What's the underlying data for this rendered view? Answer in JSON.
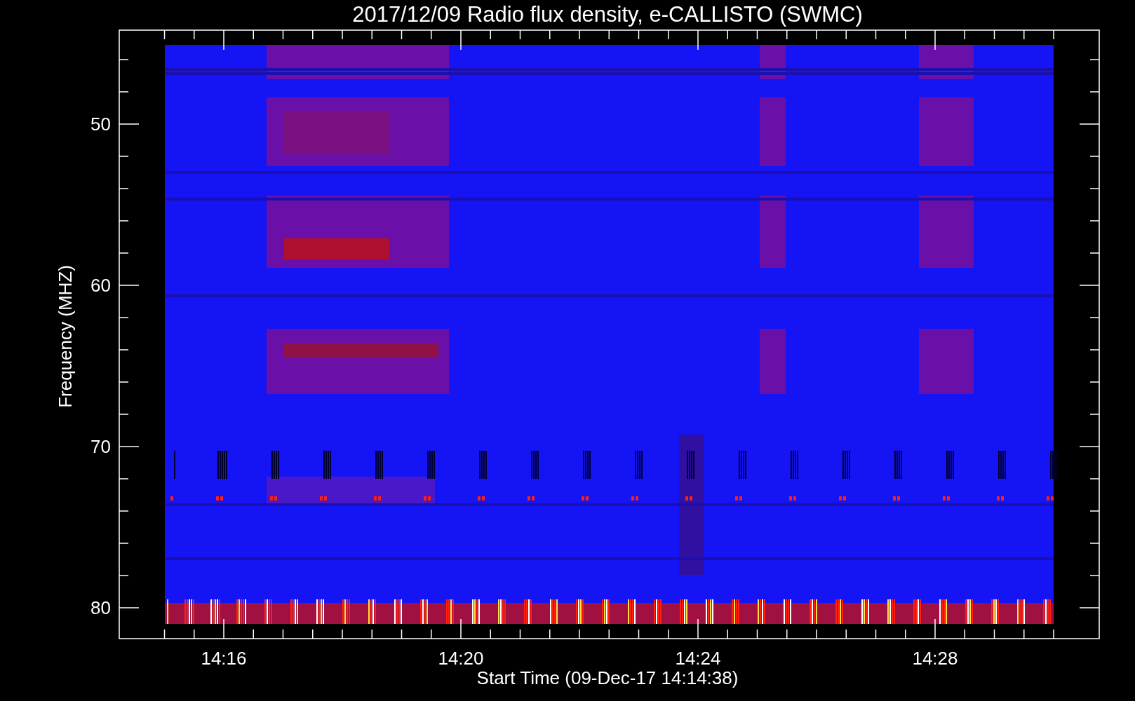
{
  "title": "2017/12/09  Radio flux density, e-CALLISTO (SWMC)",
  "plot": {
    "ylabel": "Frequency (MHZ)",
    "xlabel": "Start Time (09-Dec-17 14:14:38)",
    "yticks": [
      "50",
      "60",
      "70",
      "80"
    ],
    "xticks": [
      "14:16",
      "14:20",
      "14:24",
      "14:28"
    ]
  }
}
